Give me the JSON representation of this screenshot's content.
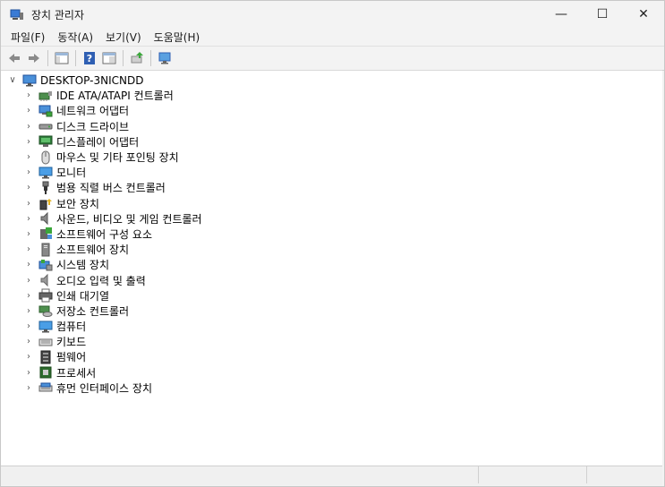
{
  "window": {
    "title": "장치 관리자"
  },
  "caption": {
    "minimize": "—",
    "maximize": "☐",
    "close": "✕"
  },
  "menu": {
    "items": [
      {
        "label": "파일(F)"
      },
      {
        "label": "동작(A)"
      },
      {
        "label": "보기(V)"
      },
      {
        "label": "도움말(H)"
      }
    ]
  },
  "tree": {
    "root": {
      "label": "DESKTOP-3NICNDD",
      "expander": "∨"
    },
    "collapsed_glyph": "›",
    "children": [
      {
        "label": "IDE ATA/ATAPI 컨트롤러",
        "icon": "ide-controller-icon"
      },
      {
        "label": "네트워크 어댑터",
        "icon": "network-adapter-icon"
      },
      {
        "label": "디스크 드라이브",
        "icon": "disk-drive-icon"
      },
      {
        "label": "디스플레이 어댑터",
        "icon": "display-adapter-icon"
      },
      {
        "label": "마우스 및 기타 포인팅 장치",
        "icon": "mouse-icon"
      },
      {
        "label": "모니터",
        "icon": "monitor-icon"
      },
      {
        "label": "범용 직렬 버스 컨트롤러",
        "icon": "usb-icon"
      },
      {
        "label": "보안 장치",
        "icon": "security-device-icon"
      },
      {
        "label": "사운드, 비디오 및 게임 컨트롤러",
        "icon": "speaker-icon"
      },
      {
        "label": "소프트웨어 구성 요소",
        "icon": "software-component-icon"
      },
      {
        "label": "소프트웨어 장치",
        "icon": "software-device-icon"
      },
      {
        "label": "시스템 장치",
        "icon": "system-device-icon"
      },
      {
        "label": "오디오 입력 및 출력",
        "icon": "audio-io-icon"
      },
      {
        "label": "인쇄 대기열",
        "icon": "printer-icon"
      },
      {
        "label": "저장소 컨트롤러",
        "icon": "storage-controller-icon"
      },
      {
        "label": "컴퓨터",
        "icon": "computer-icon"
      },
      {
        "label": "키보드",
        "icon": "keyboard-icon"
      },
      {
        "label": "펌웨어",
        "icon": "firmware-icon"
      },
      {
        "label": "프로세서",
        "icon": "processor-icon"
      },
      {
        "label": "휴먼 인터페이스 장치",
        "icon": "hid-icon"
      }
    ]
  }
}
